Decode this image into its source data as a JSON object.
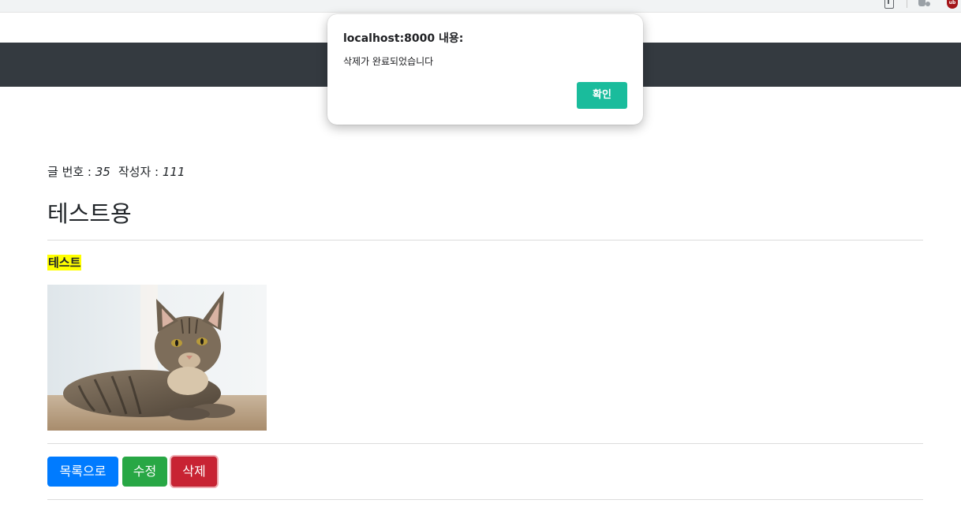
{
  "browser": {
    "icons": [
      "share-icon",
      "extensions-icon",
      "profile-icon"
    ],
    "profile_badge": "ub"
  },
  "navbar": {
    "color": "#343a40"
  },
  "post": {
    "number_label": "글 번호 : ",
    "number_value": "35",
    "author_label": "작성자 : ",
    "author_value": "111",
    "title": "테스트용",
    "highlighted_text": "테스트",
    "highlight_color": "#ffff00",
    "image_alt": "cat photo"
  },
  "actions": {
    "list_label": "목록으로",
    "edit_label": "수정",
    "delete_label": "삭제",
    "list_color": "#007bff",
    "edit_color": "#28a745",
    "delete_color": "#c82333"
  },
  "dialog": {
    "title": "localhost:8000 내용:",
    "message": "삭제가 완료되었습니다",
    "ok_label": "확인",
    "ok_color": "#1abc9c"
  }
}
